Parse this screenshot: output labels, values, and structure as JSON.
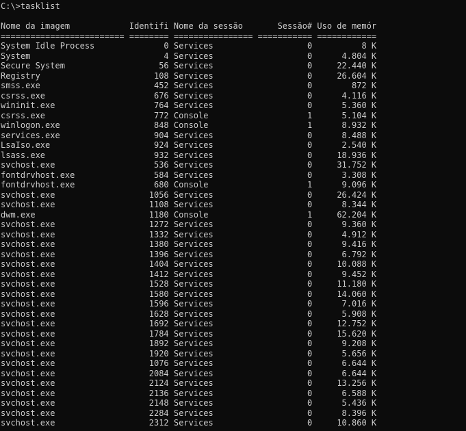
{
  "prompt": "C:\\>tasklist",
  "header_line": "Nome da imagem            Identifi Nome da sessão       Sessão# Uso de memór",
  "separator_line": "========================= ======== ================ =========== ============",
  "processes": [
    {
      "image": "System Idle Process",
      "pid": "0",
      "session_name": "Services",
      "session": "0",
      "mem": "8 K"
    },
    {
      "image": "System",
      "pid": "4",
      "session_name": "Services",
      "session": "0",
      "mem": "4.804 K"
    },
    {
      "image": "Secure System",
      "pid": "56",
      "session_name": "Services",
      "session": "0",
      "mem": "22.440 K"
    },
    {
      "image": "Registry",
      "pid": "108",
      "session_name": "Services",
      "session": "0",
      "mem": "26.604 K"
    },
    {
      "image": "smss.exe",
      "pid": "452",
      "session_name": "Services",
      "session": "0",
      "mem": "872 K"
    },
    {
      "image": "csrss.exe",
      "pid": "676",
      "session_name": "Services",
      "session": "0",
      "mem": "4.116 K"
    },
    {
      "image": "wininit.exe",
      "pid": "764",
      "session_name": "Services",
      "session": "0",
      "mem": "5.360 K"
    },
    {
      "image": "csrss.exe",
      "pid": "772",
      "session_name": "Console",
      "session": "1",
      "mem": "5.104 K"
    },
    {
      "image": "winlogon.exe",
      "pid": "848",
      "session_name": "Console",
      "session": "1",
      "mem": "8.932 K"
    },
    {
      "image": "services.exe",
      "pid": "904",
      "session_name": "Services",
      "session": "0",
      "mem": "8.488 K"
    },
    {
      "image": "LsaIso.exe",
      "pid": "924",
      "session_name": "Services",
      "session": "0",
      "mem": "2.540 K"
    },
    {
      "image": "lsass.exe",
      "pid": "932",
      "session_name": "Services",
      "session": "0",
      "mem": "18.936 K"
    },
    {
      "image": "svchost.exe",
      "pid": "536",
      "session_name": "Services",
      "session": "0",
      "mem": "31.752 K"
    },
    {
      "image": "fontdrvhost.exe",
      "pid": "584",
      "session_name": "Services",
      "session": "0",
      "mem": "3.308 K"
    },
    {
      "image": "fontdrvhost.exe",
      "pid": "680",
      "session_name": "Console",
      "session": "1",
      "mem": "9.096 K"
    },
    {
      "image": "svchost.exe",
      "pid": "1056",
      "session_name": "Services",
      "session": "0",
      "mem": "26.424 K"
    },
    {
      "image": "svchost.exe",
      "pid": "1108",
      "session_name": "Services",
      "session": "0",
      "mem": "8.344 K"
    },
    {
      "image": "dwm.exe",
      "pid": "1180",
      "session_name": "Console",
      "session": "1",
      "mem": "62.204 K"
    },
    {
      "image": "svchost.exe",
      "pid": "1272",
      "session_name": "Services",
      "session": "0",
      "mem": "9.360 K"
    },
    {
      "image": "svchost.exe",
      "pid": "1332",
      "session_name": "Services",
      "session": "0",
      "mem": "4.912 K"
    },
    {
      "image": "svchost.exe",
      "pid": "1380",
      "session_name": "Services",
      "session": "0",
      "mem": "9.416 K"
    },
    {
      "image": "svchost.exe",
      "pid": "1396",
      "session_name": "Services",
      "session": "0",
      "mem": "6.792 K"
    },
    {
      "image": "svchost.exe",
      "pid": "1404",
      "session_name": "Services",
      "session": "0",
      "mem": "10.088 K"
    },
    {
      "image": "svchost.exe",
      "pid": "1412",
      "session_name": "Services",
      "session": "0",
      "mem": "9.452 K"
    },
    {
      "image": "svchost.exe",
      "pid": "1528",
      "session_name": "Services",
      "session": "0",
      "mem": "11.180 K"
    },
    {
      "image": "svchost.exe",
      "pid": "1580",
      "session_name": "Services",
      "session": "0",
      "mem": "14.060 K"
    },
    {
      "image": "svchost.exe",
      "pid": "1596",
      "session_name": "Services",
      "session": "0",
      "mem": "7.016 K"
    },
    {
      "image": "svchost.exe",
      "pid": "1628",
      "session_name": "Services",
      "session": "0",
      "mem": "5.908 K"
    },
    {
      "image": "svchost.exe",
      "pid": "1692",
      "session_name": "Services",
      "session": "0",
      "mem": "12.752 K"
    },
    {
      "image": "svchost.exe",
      "pid": "1784",
      "session_name": "Services",
      "session": "0",
      "mem": "15.620 K"
    },
    {
      "image": "svchost.exe",
      "pid": "1892",
      "session_name": "Services",
      "session": "0",
      "mem": "9.208 K"
    },
    {
      "image": "svchost.exe",
      "pid": "1920",
      "session_name": "Services",
      "session": "0",
      "mem": "5.656 K"
    },
    {
      "image": "svchost.exe",
      "pid": "1076",
      "session_name": "Services",
      "session": "0",
      "mem": "6.644 K"
    },
    {
      "image": "svchost.exe",
      "pid": "2084",
      "session_name": "Services",
      "session": "0",
      "mem": "6.644 K"
    },
    {
      "image": "svchost.exe",
      "pid": "2124",
      "session_name": "Services",
      "session": "0",
      "mem": "13.256 K"
    },
    {
      "image": "svchost.exe",
      "pid": "2136",
      "session_name": "Services",
      "session": "0",
      "mem": "6.588 K"
    },
    {
      "image": "svchost.exe",
      "pid": "2148",
      "session_name": "Services",
      "session": "0",
      "mem": "5.436 K"
    },
    {
      "image": "svchost.exe",
      "pid": "2284",
      "session_name": "Services",
      "session": "0",
      "mem": "8.396 K"
    },
    {
      "image": "svchost.exe",
      "pid": "2312",
      "session_name": "Services",
      "session": "0",
      "mem": "10.860 K"
    }
  ]
}
